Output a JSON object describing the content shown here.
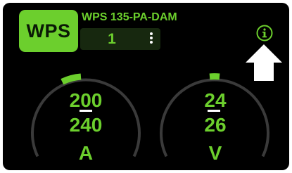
{
  "app": {
    "logo_text": "WPS",
    "model": "WPS 135-PA-DAM",
    "program_number": "1",
    "info_icon": "info-icon",
    "menu_icon": "kebab-menu-icon",
    "arrow_icon": "arrow-up-icon"
  },
  "gauges": [
    {
      "name": "current",
      "set_value": "200",
      "actual_value": "240",
      "unit": "A",
      "level": 0.5
    },
    {
      "name": "voltage",
      "set_value": "24",
      "actual_value": "26",
      "unit": "V",
      "level": 0.5
    }
  ],
  "colors": {
    "accent": "#6ccf2d",
    "background": "#000000",
    "track": "#3a3a3a",
    "program_box": "#17280f"
  }
}
